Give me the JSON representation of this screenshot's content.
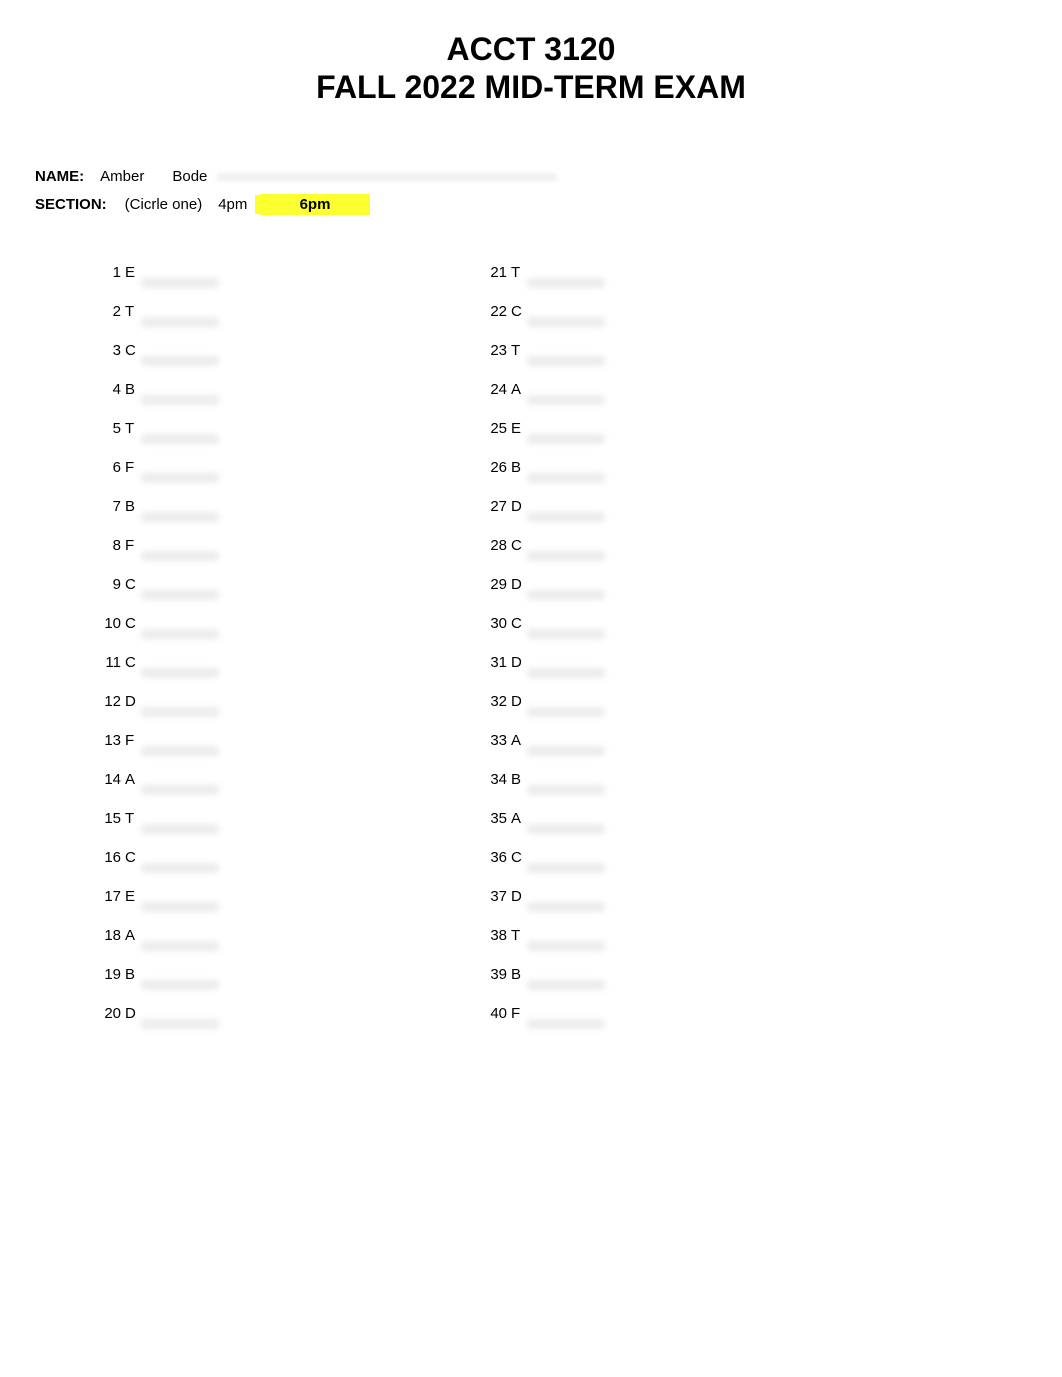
{
  "title": {
    "line1": "ACCT 3120",
    "line2": "FALL 2022 MID-TERM EXAM"
  },
  "name": {
    "label": "NAME:",
    "first": "Amber",
    "last": "Bode"
  },
  "section": {
    "label": "SECTION:",
    "circle_one": "(Cicrle one)",
    "opt1": "4pm",
    "opt2": "6pm"
  },
  "answers_col1": [
    {
      "n": "1",
      "a": "E"
    },
    {
      "n": "2",
      "a": "T"
    },
    {
      "n": "3",
      "a": "C"
    },
    {
      "n": "4",
      "a": "B"
    },
    {
      "n": "5",
      "a": "T"
    },
    {
      "n": "6",
      "a": "F"
    },
    {
      "n": "7",
      "a": "B"
    },
    {
      "n": "8",
      "a": "F"
    },
    {
      "n": "9",
      "a": "C"
    },
    {
      "n": "10",
      "a": "C"
    },
    {
      "n": "11",
      "a": "C"
    },
    {
      "n": "12",
      "a": "D"
    },
    {
      "n": "13",
      "a": "F"
    },
    {
      "n": "14",
      "a": "A"
    },
    {
      "n": "15",
      "a": "T"
    },
    {
      "n": "16",
      "a": "C"
    },
    {
      "n": "17",
      "a": "E"
    },
    {
      "n": "18",
      "a": "A"
    },
    {
      "n": "19",
      "a": "B"
    },
    {
      "n": "20",
      "a": "D"
    }
  ],
  "answers_col2": [
    {
      "n": "21",
      "a": "T"
    },
    {
      "n": "22",
      "a": "C"
    },
    {
      "n": "23",
      "a": "T"
    },
    {
      "n": "24",
      "a": "A"
    },
    {
      "n": "25",
      "a": "E"
    },
    {
      "n": "26",
      "a": "B"
    },
    {
      "n": "27",
      "a": "D"
    },
    {
      "n": "28",
      "a": "C"
    },
    {
      "n": "29",
      "a": "D"
    },
    {
      "n": "30",
      "a": "C"
    },
    {
      "n": "31",
      "a": "D"
    },
    {
      "n": "32",
      "a": "D"
    },
    {
      "n": "33",
      "a": "A"
    },
    {
      "n": "34",
      "a": "B"
    },
    {
      "n": "35",
      "a": "A"
    },
    {
      "n": "36",
      "a": "C"
    },
    {
      "n": "37",
      "a": "D"
    },
    {
      "n": "38",
      "a": "T"
    },
    {
      "n": "39",
      "a": "B"
    },
    {
      "n": "40",
      "a": "F"
    }
  ]
}
